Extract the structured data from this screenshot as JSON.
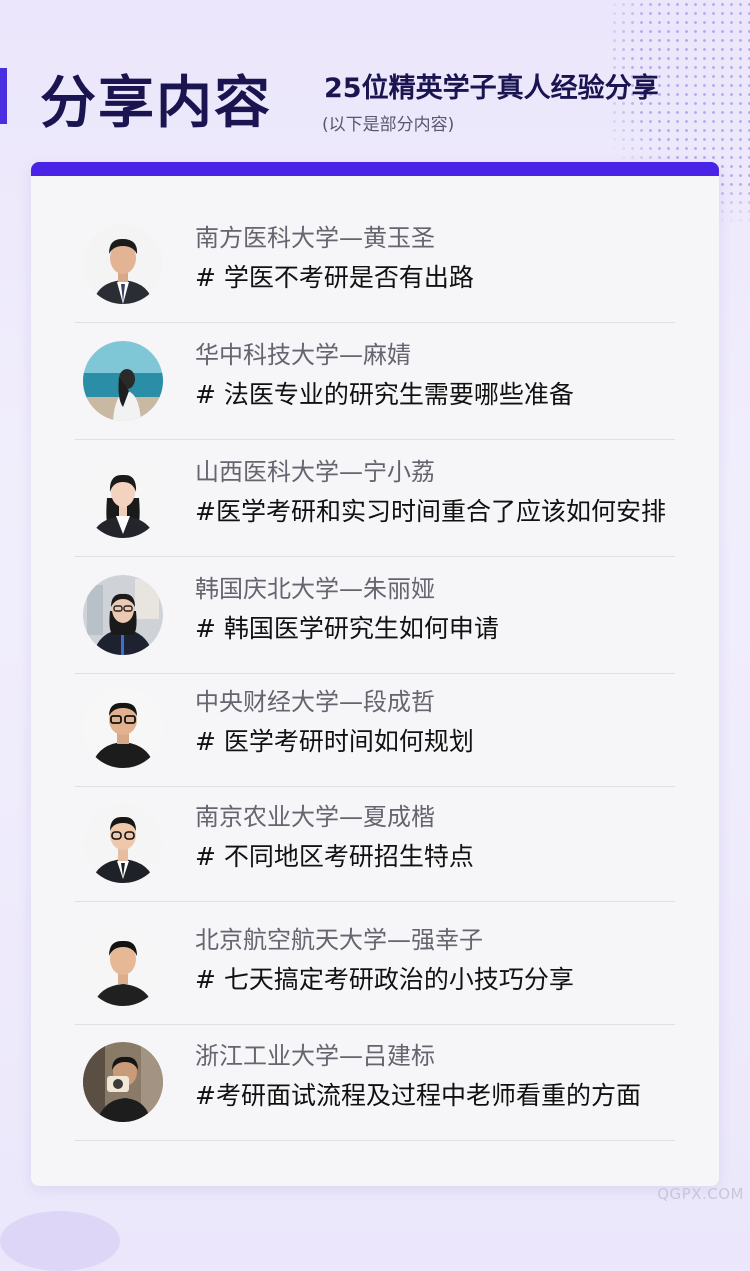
{
  "header": {
    "title": "分享内容",
    "headline": "25位精英学子真人经验分享",
    "subline": "(以下是部分内容)"
  },
  "colors": {
    "accent": "#4a23e6",
    "title": "#1a1550",
    "card": "#f6f6f8"
  },
  "items": [
    {
      "name": "南方医科大学—黄玉圣",
      "topic": "# 学医不考研是否有出路",
      "avatar": "man-portrait-suit"
    },
    {
      "name": "华中科技大学—麻婧",
      "topic": "# 法医专业的研究生需要哪些准备",
      "avatar": "woman-seaside-photo"
    },
    {
      "name": "山西医科大学—宁小荔",
      "topic": "#医学考研和实习时间重合了应该如何安排",
      "avatar": "woman-portrait-suit"
    },
    {
      "name": "韩国庆北大学—朱丽娅",
      "topic": "# 韩国医学研究生如何申请",
      "avatar": "woman-glasses-photo"
    },
    {
      "name": "中央财经大学—段成哲",
      "topic": "# 医学考研时间如何规划",
      "avatar": "man-glasses-portrait"
    },
    {
      "name": "南京农业大学—夏成楷",
      "topic": "# 不同地区考研招生特点",
      "avatar": "man-glasses-suit"
    },
    {
      "name": "北京航空航天大学—强幸子",
      "topic": "# 七天搞定考研政治的小技巧分享",
      "avatar": "man-portrait"
    },
    {
      "name": "浙江工业大学—吕建标",
      "topic": "#考研面试流程及过程中老师看重的方面",
      "avatar": "man-camera-photo"
    }
  ],
  "watermark": "QGPX.COM"
}
